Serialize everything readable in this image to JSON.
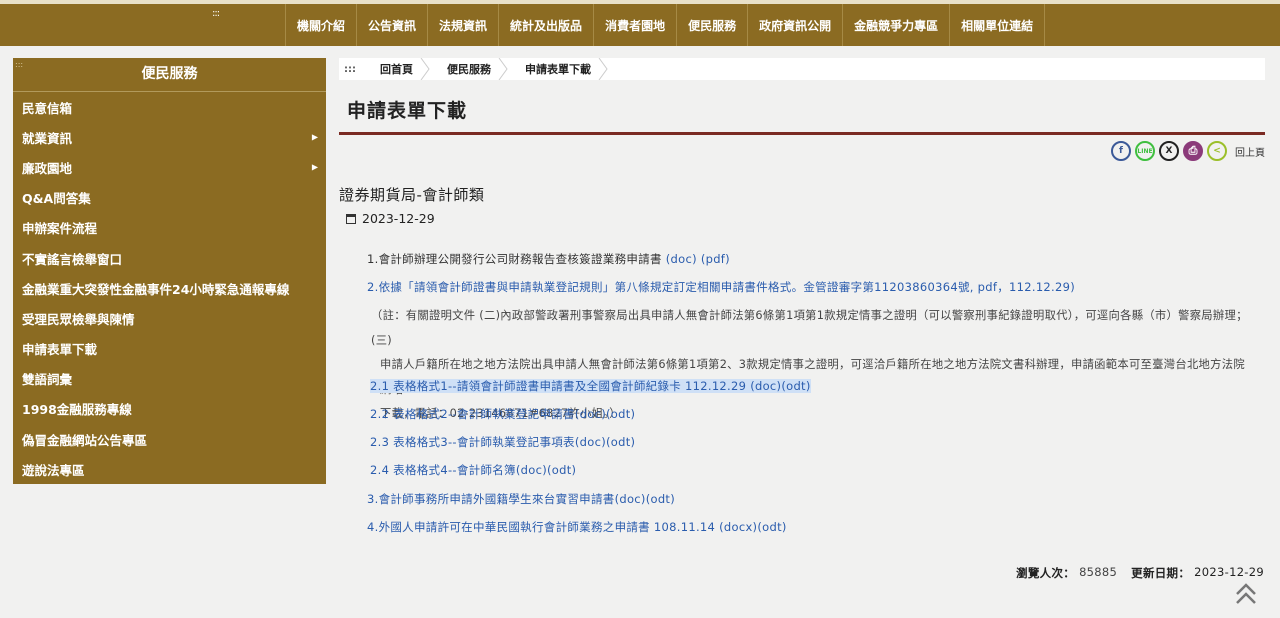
{
  "header": {
    "nav": [
      "機關介紹",
      "公告資訊",
      "法規資訊",
      "統計及出版品",
      "消費者園地",
      "便民服務",
      "政府資訊公開",
      "金融競爭力專區",
      "相關單位連結"
    ],
    "dots": ":::"
  },
  "sidebar": {
    "title": "便民服務",
    "items": [
      {
        "label": "民意信箱",
        "has_sub": false
      },
      {
        "label": "就業資訊",
        "has_sub": true
      },
      {
        "label": "廉政園地",
        "has_sub": true
      },
      {
        "label": "Q&A問答集",
        "has_sub": false
      },
      {
        "label": "申辦案件流程",
        "has_sub": false
      },
      {
        "label": "不實謠言檢舉窗口",
        "has_sub": false
      },
      {
        "label": "金融業重大突發性金融事件24小時緊急通報專線",
        "has_sub": false
      },
      {
        "label": "受理民眾檢舉與陳情",
        "has_sub": false
      },
      {
        "label": "申請表單下載",
        "has_sub": false
      },
      {
        "label": "雙語詞彙",
        "has_sub": false
      },
      {
        "label": "1998金融服務專線",
        "has_sub": false
      },
      {
        "label": "偽冒金融網站公告專區",
        "has_sub": false
      },
      {
        "label": "遊說法專區",
        "has_sub": false
      }
    ]
  },
  "breadcrumb": {
    "dots": ":::",
    "items": [
      "回首頁",
      "便民服務",
      "申請表單下載"
    ]
  },
  "page": {
    "title": "申請表單下載",
    "back_label": "回上頁",
    "section_title": "證券期貨局-會計師類",
    "date": "2023-12-29"
  },
  "share_icons": [
    {
      "name": "facebook-icon",
      "glyph": "f",
      "color": "#3b5998"
    },
    {
      "name": "line-icon",
      "glyph": "LINE",
      "color": "#3fbf3f"
    },
    {
      "name": "x-icon",
      "glyph": "X",
      "color": "#222222"
    },
    {
      "name": "print-icon",
      "glyph": "⎙",
      "color": "#8b3a7a"
    },
    {
      "name": "back-icon",
      "glyph": "<",
      "color": "#9bbf2a"
    }
  ],
  "documents": {
    "item1": {
      "prefix": "1.會計師辦理公開發行公司財務報告查核簽證業務申請書 ",
      "links": "(doc) (pdf)"
    },
    "item2": "2.依據「請領會計師證書與申請執業登記規則」第八條規定訂定相關申請書件格式。金管證審字第11203860364號, pdf，112.12.29)",
    "note_l1": "（註：有關證明文件 (二)內政部警政署刑事警察局出具申請人無會計師法第6條第1項第1款規定情事之證明（可以警察刑事紀錄證明取代），可逕向各縣（市）警察局辦理；(三)",
    "note_l2": "申請人戶籍所在地之地方法院出具申請人無會計師法第6條第1項第2、3款規定情事之證明，可逕洽戶籍所在地之地方法院文書科辦理，申請函範本可至臺灣台北地方法院網站",
    "note_l3": "下載，電話：02-23146871#6827許小姐。）",
    "sub1": "2.1 表格格式1--請領會計師證書申請書及全國會計師紀錄卡 112.12.29 (doc)(odt)",
    "sub2": "2.2  表格格式2--會計師執業登記申請書(doc)(odt)",
    "sub3": "2.3  表格格式3--會計師執業登記事項表(doc)(odt)",
    "sub4": "2.4  表格格式4--會計師名簿(doc)(odt)",
    "item3": "3.會計師事務所申請外國籍學生來台實習申請書(doc)(odt)",
    "item4": "4.外國人申請許可在中華民國執行會計師業務之申請書 108.11.14 (docx)(odt)"
  },
  "footer": {
    "views_label": "瀏覽人次：",
    "views_value": "85885",
    "updated_label": "更新日期：",
    "updated_value": "2023-12-29"
  }
}
